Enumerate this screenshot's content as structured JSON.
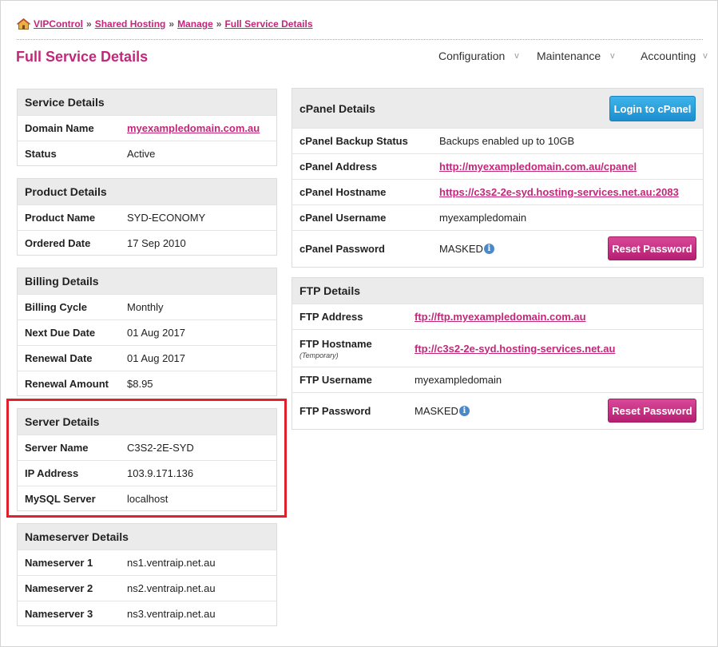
{
  "breadcrumb": {
    "items": [
      "VIPControl",
      "Shared Hosting",
      "Manage",
      "Full Service Details"
    ],
    "separator": "»"
  },
  "page": {
    "title": "Full Service Details"
  },
  "nav": [
    {
      "label": "Configuration"
    },
    {
      "label": "Maintenance"
    },
    {
      "label": "Accounting"
    }
  ],
  "service": {
    "title": "Service Details",
    "rows": [
      {
        "label": "Domain Name",
        "value": "myexampledomain.com.au"
      },
      {
        "label": "Status",
        "value": "Active"
      }
    ]
  },
  "product": {
    "title": "Product Details",
    "rows": [
      {
        "label": "Product Name",
        "value": "SYD-ECONOMY"
      },
      {
        "label": "Ordered Date",
        "value": "17 Sep 2010"
      }
    ]
  },
  "billing": {
    "title": "Billing Details",
    "rows": [
      {
        "label": "Billing Cycle",
        "value": "Monthly"
      },
      {
        "label": "Next Due Date",
        "value": "01 Aug 2017"
      },
      {
        "label": "Renewal Date",
        "value": "01 Aug 2017"
      },
      {
        "label": "Renewal Amount",
        "value": "$8.95"
      }
    ]
  },
  "server": {
    "title": "Server Details",
    "rows": [
      {
        "label": "Server Name",
        "value": "C3S2-2E-SYD"
      },
      {
        "label": "IP Address",
        "value": "103.9.171.136"
      },
      {
        "label": "MySQL Server",
        "value": "localhost"
      }
    ]
  },
  "nameserver": {
    "title": "Nameserver Details",
    "rows": [
      {
        "label": "Nameserver 1",
        "value": "ns1.ventraip.net.au"
      },
      {
        "label": "Nameserver 2",
        "value": "ns2.ventraip.net.au"
      },
      {
        "label": "Nameserver 3",
        "value": "ns3.ventraip.net.au"
      }
    ]
  },
  "cpanel": {
    "title": "cPanel Details",
    "login_label": "Login to cPanel",
    "rows": [
      {
        "label": "cPanel Backup Status",
        "value": "Backups enabled up to 10GB"
      },
      {
        "label": "cPanel Address",
        "value": "http://myexampledomain.com.au/cpanel"
      },
      {
        "label": "cPanel Hostname",
        "value": "https://c3s2-2e-syd.hosting-services.net.au:2083"
      },
      {
        "label": "cPanel Username",
        "value": "myexampledomain"
      },
      {
        "label": "cPanel Password",
        "value": "MASKED"
      }
    ],
    "reset_label": "Reset Password"
  },
  "ftp": {
    "title": "FTP Details",
    "rows": [
      {
        "label": "FTP Address",
        "value": "ftp://ftp.myexampledomain.com.au"
      },
      {
        "label": "FTP Hostname",
        "note": "(Temporary)",
        "value": "ftp://c3s2-2e-syd.hosting-services.net.au"
      },
      {
        "label": "FTP Username",
        "value": "myexampledomain"
      },
      {
        "label": "FTP Password",
        "value": "MASKED"
      }
    ],
    "reset_label": "Reset Password"
  },
  "icons": {
    "home": "home-icon",
    "info": "info-icon",
    "chevron": "chevron-down-icon"
  },
  "colors": {
    "accent": "#c2277a",
    "login_button": "#2a9fdc",
    "reset_button": "#c32b80",
    "highlight": "#e0202a"
  }
}
